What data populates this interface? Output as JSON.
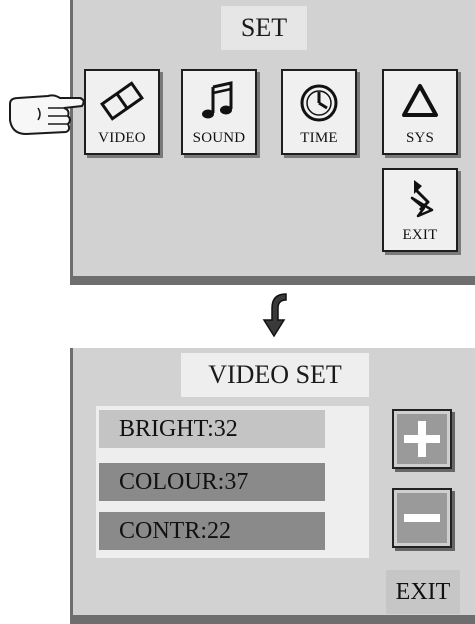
{
  "set_menu": {
    "title": "SET",
    "buttons": {
      "video": "VIDEO",
      "sound": "SOUND",
      "time": "TIME",
      "sys": "SYS",
      "exit": "EXIT"
    }
  },
  "video_set": {
    "title": "VIDEO SET",
    "rows": [
      "BRIGHT:32",
      "COLOUR:37",
      "CONTR:22"
    ],
    "increase_icon": "plus-icon",
    "decrease_icon": "minus-icon",
    "exit": "EXIT"
  },
  "icons": {
    "hand": "pointing-hand-icon",
    "arrow": "down-arrow-icon",
    "video": "film-icon",
    "sound": "music-note-icon",
    "time": "clock-icon",
    "sys": "triangle-icon",
    "exit": "exit-arrow-icon"
  }
}
